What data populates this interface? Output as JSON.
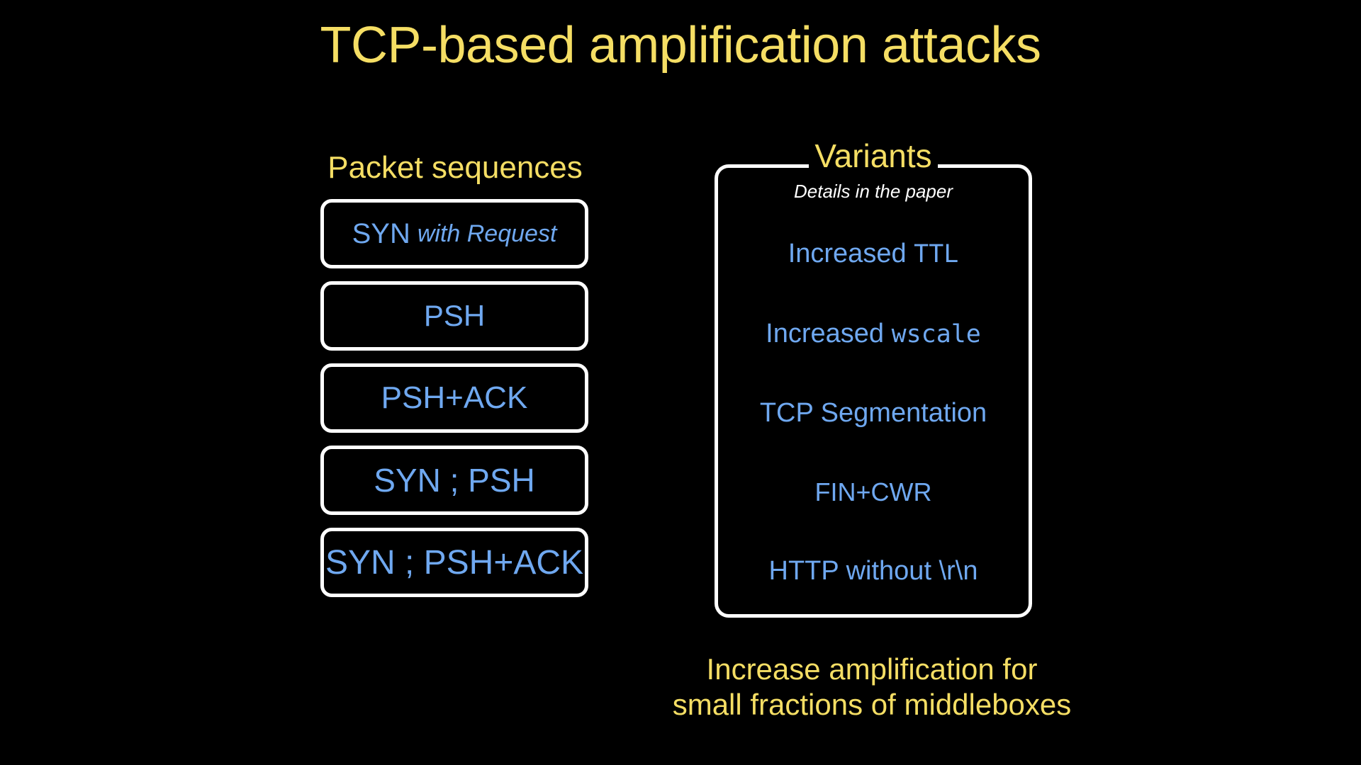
{
  "slide": {
    "title": "TCP-based amplification attacks",
    "background_color": "#000000",
    "accent_yellow": "#F5DE64",
    "accent_blue": "#6FA8F0",
    "border_white": "#FFFFFF"
  },
  "left_column": {
    "heading": "Packet sequences",
    "boxes": [
      {
        "lead": "SYN",
        "italic": "with Request",
        "full_text": "SYN with Request"
      },
      {
        "lead": "PSH",
        "italic": "",
        "full_text": "PSH"
      },
      {
        "lead": "PSH+ACK",
        "italic": "",
        "full_text": "PSH+ACK"
      },
      {
        "lead": "SYN ; PSH",
        "italic": "",
        "full_text": "SYN ; PSH"
      },
      {
        "lead": "SYN ; PSH+ACK",
        "italic": "",
        "full_text": "SYN ; PSH+ACK"
      }
    ]
  },
  "right_column": {
    "legend": "Variants",
    "subtitle": "Details in the paper",
    "items": [
      {
        "prefix": "Increased ",
        "code": "TTL",
        "suffix": "",
        "full_text": "Increased TTL"
      },
      {
        "prefix": "Increased ",
        "code": "wscale",
        "suffix": "",
        "full_text": "Increased wscale"
      },
      {
        "prefix": "TCP Segmentation",
        "code": "",
        "suffix": "",
        "full_text": "TCP Segmentation"
      },
      {
        "prefix": "FIN+CWR",
        "code": "",
        "suffix": "",
        "full_text": "FIN+CWR"
      },
      {
        "prefix": "HTTP without \\r\\n",
        "code": "",
        "suffix": "",
        "full_text": "HTTP without \\r\\n"
      }
    ]
  },
  "bottom_caption": {
    "line1": "Increase amplification for",
    "line2": "small fractions of middleboxes"
  }
}
